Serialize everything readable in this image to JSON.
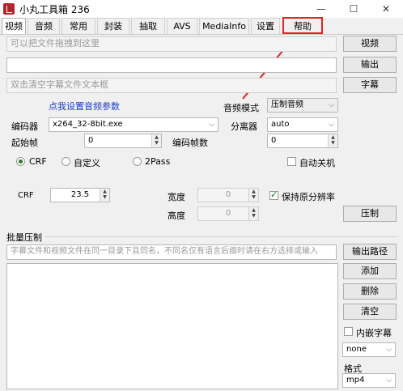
{
  "window": {
    "title": "小丸工具箱 236"
  },
  "titlebar": {
    "minimize": "—",
    "maximize": "☐",
    "close": "✕"
  },
  "tabs": [
    "视频",
    "音频",
    "常用",
    "封装",
    "抽取",
    "AVS",
    "MediaInfo",
    "设置",
    "帮助"
  ],
  "video": {
    "drop_hint": "可以把文件拖拽到这里",
    "subtitle_hint": "双击清空字幕文件文本框",
    "btn_video": "视频",
    "btn_output": "输出",
    "btn_subtitle": "字幕",
    "audio_link": "点我设置音频参数",
    "audio_mode_label": "音频模式",
    "audio_mode_value": "压制音频",
    "encoder_label": "编码器",
    "encoder_value": "x264_32-8bit.exe",
    "separator_label": "分离器",
    "separator_value": "auto",
    "start_frame_label": "起始帧",
    "start_frame_value": "0",
    "encode_frames_label": "编码帧数",
    "encode_frames_value": "0",
    "mode_crf": "CRF",
    "mode_custom": "自定义",
    "mode_2pass": "2Pass",
    "auto_shutdown": "自动关机",
    "crf_label": "CRF",
    "crf_value": "23.5",
    "width_label": "宽度",
    "width_value": "0",
    "height_label": "高度",
    "height_value": "0",
    "keep_res": "保持原分辨率",
    "btn_compress": "压制"
  },
  "batch": {
    "title": "批量压制",
    "hint": "字幕文件和视频文件在同一目录下且同名，不同名仅有语言后缀时请在右方选择或输入",
    "btn_output_path": "输出路径",
    "btn_add": "添加",
    "btn_delete": "删除",
    "btn_clear": "清空",
    "embed_subtitle": "内嵌字幕",
    "subtitle_lang": "none",
    "format_label": "格式",
    "format_value": "mp4"
  },
  "annotation": {
    "arrow_color": "#e02424"
  }
}
